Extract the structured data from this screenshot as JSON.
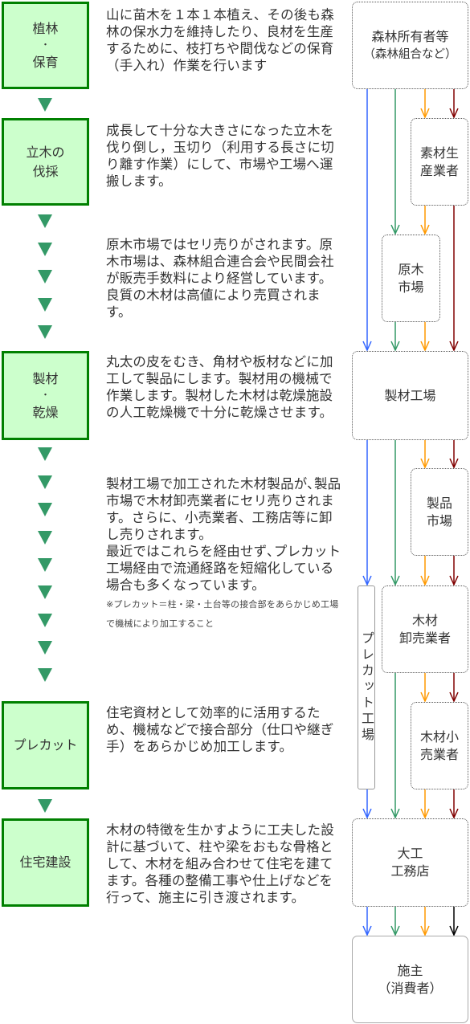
{
  "stages": [
    {
      "lines": [
        "植林",
        "・",
        "保育"
      ]
    },
    {
      "lines": [
        "立木の",
        "伐採"
      ]
    },
    {
      "lines": [
        "製材",
        "・",
        "乾燥"
      ]
    },
    {
      "lines": [
        "プレカット"
      ]
    },
    {
      "lines": [
        "住宅建設"
      ]
    }
  ],
  "descriptions": [
    {
      "text": "山に苗木を１本１本植え、その後も森林の保水力を維持したり、良材を生産するために、枝打ちや間伐などの保育（手入れ）作業を行います"
    },
    {
      "text": "成長して十分な大きさになった立木を伐り倒し，玉切り（利用する長さに切り離す作業）にして、市場や工場へ運搬します。"
    },
    {
      "text": "原木市場ではセリ売りがされます。原木市場は、森林組合連合会や民間会社が販売手数料により経営しています。良質の木材は高値により売買されます。"
    },
    {
      "text": "丸太の皮をむき、角材や板材などに加工して製品にします。製材用の機械で作業します。製材した木材は乾燥施設の人工乾燥機で十分に乾燥させます。"
    },
    {
      "text": "製材工場で加工された木材製品が､製品市場で木材卸売業者にセリ売りされます。さらに、小売業者、工務店等に卸し売りされます。",
      "text2": "最近ではこれらを経由せず､プレカット工場経由で流通経路を短縮化している場合も多くなっています。",
      "note": "※プレカット＝柱・梁・土台等の接合部をあらかじめ工場で機械により加工すること"
    },
    {
      "text": "住宅資材として効率的に活用するため、機械などで接合部分（仕口や継ぎ手）をあらかじめ加工します。"
    },
    {
      "text": "木材の特徴を生かすように工夫した設計に基づいて、柱や梁をおもな骨格として、木材を組み合わせて住宅を建てます。各種の整備工事や仕上げなどを行って、施主に引き渡されます。"
    }
  ],
  "nodes": {
    "forest_owner": {
      "line1": "森林所有者等",
      "line2": "（森林組合など）"
    },
    "log_producer": {
      "line1": "素材生",
      "line2": "産業者"
    },
    "log_market": {
      "line1": "原木",
      "line2": "市場"
    },
    "sawmill": {
      "line1": "製材工場"
    },
    "product_market": {
      "line1": "製品",
      "line2": "市場"
    },
    "precut_factory": {
      "line1": "プレカット工場"
    },
    "wholesaler": {
      "line1": "木材",
      "line2": "卸売業者"
    },
    "retailer": {
      "line1": "木材小",
      "line2": "売業者"
    },
    "builder": {
      "line1": "大工",
      "line2": "工務店"
    },
    "client": {
      "line1": "施主",
      "line2": "（消費者）"
    }
  },
  "colors": {
    "stage_fill": "#ccffcc",
    "stage_border": "#008000",
    "triangle": "#339966",
    "route_blue": "#3366ff",
    "route_green": "#339966",
    "route_orange": "#ff9900",
    "route_darkred": "#800000",
    "route_black": "#000000"
  }
}
